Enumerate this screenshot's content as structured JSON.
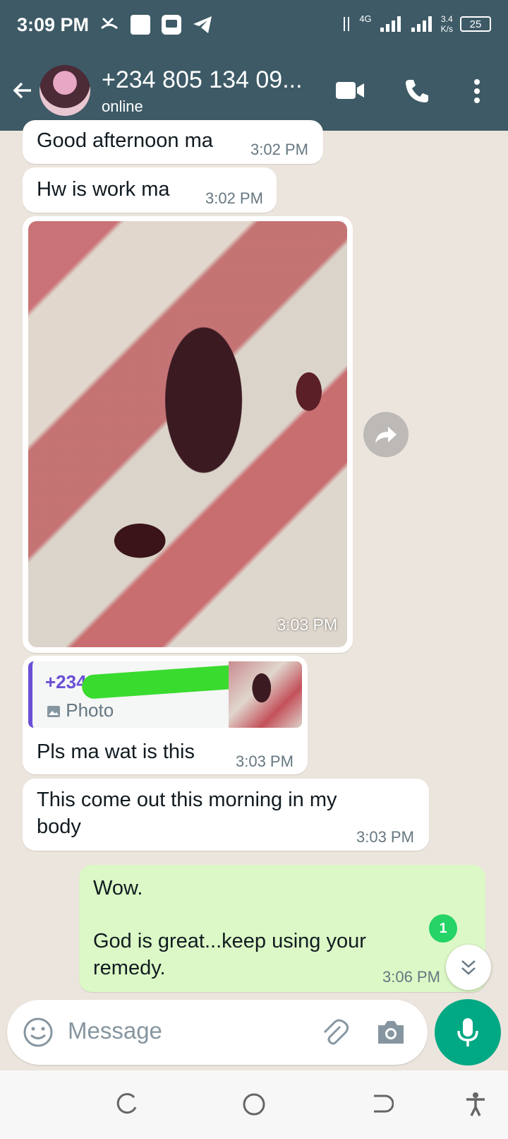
{
  "status_bar": {
    "time": "3:09 PM",
    "network": "4G",
    "speed_top": "3.4",
    "speed_bottom": "K/s",
    "battery": "25"
  },
  "header": {
    "contact_name": "+234 805 134 09...",
    "contact_status": "online"
  },
  "messages": [
    {
      "direction": "incoming",
      "text": "Good afternoon ma",
      "time": "3:02 PM"
    },
    {
      "direction": "incoming",
      "text": "Hw is work ma",
      "time": "3:02 PM"
    },
    {
      "direction": "incoming",
      "type": "photo",
      "time": "3:03 PM"
    },
    {
      "direction": "incoming",
      "quoted_author": "+234 80",
      "quoted_type": "Photo",
      "text": "Pls ma wat is this",
      "time": "3:03 PM"
    },
    {
      "direction": "incoming",
      "text_line1": "This come out this morning in my",
      "text_line2": "body",
      "time": "3:03 PM"
    },
    {
      "direction": "outgoing",
      "text_line1": "Wow.",
      "text_line2": "God is great...keep using your",
      "text_line3": "remedy.",
      "time": "3:06 PM"
    }
  ],
  "unread_count": "1",
  "composer": {
    "placeholder": "Message"
  },
  "colors": {
    "header_bg": "#3d5a66",
    "accent": "#00a884",
    "outgoing_bubble": "#dcf8c6",
    "quote_bar": "#6b4fd6"
  },
  "icons": {
    "header": [
      "back-arrow-icon",
      "video-call-icon",
      "phone-icon",
      "more-vert-icon"
    ],
    "composer": [
      "emoji-icon",
      "attach-icon",
      "camera-icon",
      "mic-icon"
    ],
    "nav": [
      "recents-icon",
      "home-icon",
      "back-icon",
      "accessibility-icon"
    ]
  }
}
